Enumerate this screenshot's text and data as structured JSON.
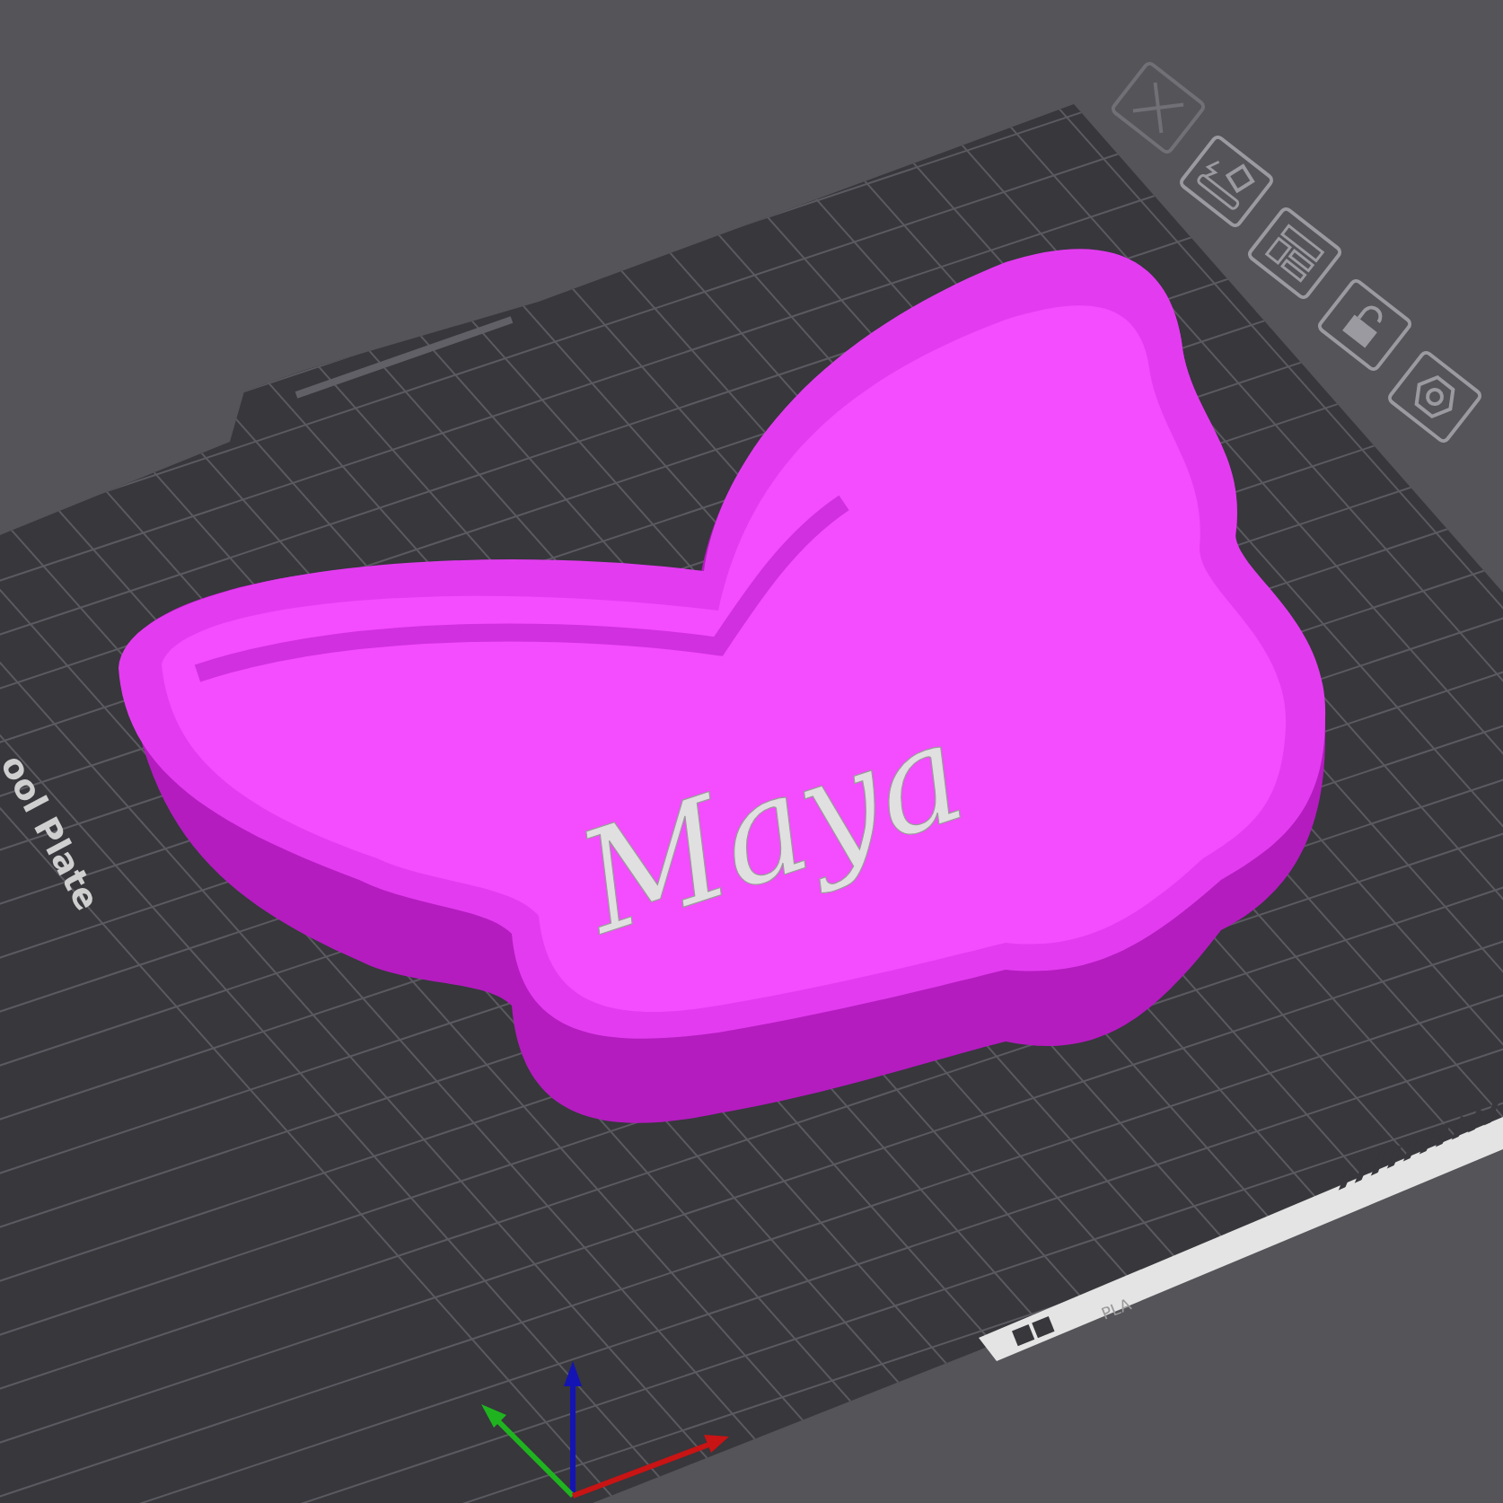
{
  "plate": {
    "label": "ool Plate"
  },
  "filament_strip": {
    "label": "PLA"
  },
  "model": {
    "text": "Maya"
  }
}
